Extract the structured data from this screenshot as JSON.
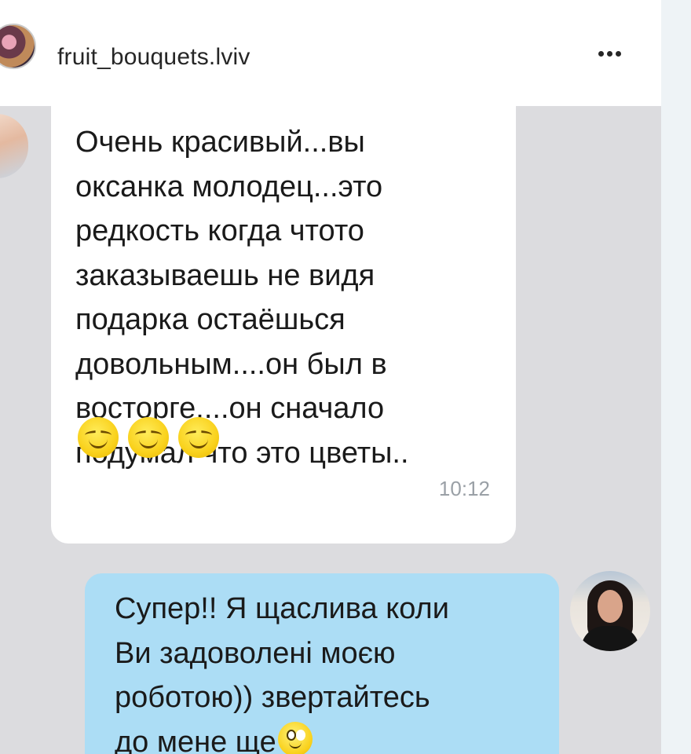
{
  "header": {
    "account_name": "fruit_bouquets.lviv",
    "avatar_icon": "profile-avatar",
    "more_icon": "more-options-icon"
  },
  "messages": [
    {
      "direction": "incoming",
      "lines": [
        "Очень красивый...вы",
        "оксанка молодец...это",
        "редкость когда чтото",
        "заказываешь не видя",
        "подарка остаёшься",
        "довольным....он был в",
        "восторге....он сначало",
        "подумал что это цветы.."
      ],
      "emoji": [
        "smiling-face-icon",
        "smiling-face-icon",
        "smiling-face-icon"
      ],
      "time": "10:12"
    },
    {
      "direction": "outgoing",
      "lines": [
        "Супер!! Я щаслива коли",
        "Ви задоволені моєю",
        "роботою)) звертайтесь",
        "до мене ще"
      ],
      "trailing_emoji": "happy-face-icon"
    }
  ],
  "colors": {
    "chat_background": "#dcdcdf",
    "incoming_bubble": "#ffffff",
    "outgoing_bubble": "#acddf5",
    "time_text": "#9aa0a6"
  }
}
